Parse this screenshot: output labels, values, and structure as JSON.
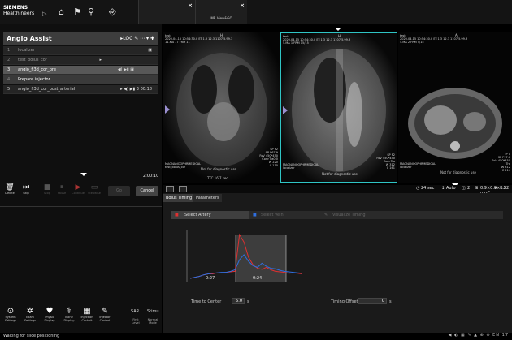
{
  "brand": {
    "line1": "SIEMENS",
    "line2": "Healthineers"
  },
  "topbar": {
    "icons": [
      "home-icon",
      "patient-browser-icon",
      "search-user-icon",
      "exam-icon"
    ],
    "tabs": [
      {
        "label": ""
      },
      {
        "label": "MR View&GO"
      }
    ]
  },
  "assist": {
    "title": "Angio Assist",
    "tools": "▸LOC ✎ ⋯ ▾ ✚",
    "rows": [
      {
        "num": "1",
        "name": "localizer",
        "ctrl": "▣"
      },
      {
        "num": "2",
        "name": "test_bolus_cor",
        "ctrl": "▸"
      },
      {
        "num": "3",
        "name": "angio_fl3d_cor_pre",
        "ctrl": "◀) ▶▮ ▣"
      },
      {
        "num": "4",
        "name": "Prepare injector",
        "ctrl": ""
      },
      {
        "num": "5",
        "name": "angio_fl3d_cor_post_arterial",
        "ctrl": "▸ ◀) ▶▮ 3     00:18"
      }
    ],
    "total_time": "2:00:10",
    "controls": [
      {
        "glyph": "🗑",
        "label": "Delete"
      },
      {
        "glyph": "⏭",
        "label": "Skip"
      },
      {
        "glyph": "■",
        "label": "Stop"
      },
      {
        "glyph": "⏸",
        "label": "Pause"
      },
      {
        "glyph": "▶",
        "label": "Continue"
      },
      {
        "glyph": "▭",
        "label": "Stepwise"
      }
    ],
    "go": "Go",
    "cancel": "Cancel"
  },
  "bottom_bar": {
    "items": [
      {
        "glyph": "⊙",
        "label": "System\nSettings"
      },
      {
        "glyph": "✲",
        "label": "Exam\nSettings"
      },
      {
        "glyph": "♥",
        "label": "Physio\nDisplay"
      },
      {
        "glyph": "⚕",
        "label": "Inline\nDisplay"
      },
      {
        "glyph": "▦",
        "label": "Injection\nCockpit"
      },
      {
        "glyph": "✎",
        "label": "Injector\nControl"
      }
    ],
    "sar": "SAR",
    "stimu": "Stimu",
    "sar_sub": "First\nLevel",
    "stimu_sub": "Normal\nMode"
  },
  "viewports": [
    {
      "overlay_tl": "test\n2020.04.15 10:54:30.0 ET:1.3 12.3 1107.5.99.3\n11.MA 17 FRM 11",
      "overlay_bl": "MAGNANOOPHRMEDICAL\ntest_bolus_cor",
      "overlay_br": "SP F2\nSP P67.9\nFoV 450*450\nCor>Tra0.0\nW 220\nC 110",
      "ndu": "Not for diagnostic use",
      "bottom": "TTC 16.7 sec",
      "orient_top": "H"
    },
    {
      "overlay_tl": "test\n2020.04.15 10:54:30.0 ET:1.3 12.3 1107.5.99.3\n5.MA 1 FRM 15/15",
      "overlay_bl": "MAGNANOOPHRMEDICAL\nlocalizer",
      "overlay_br": "SP F2\nFoV 450*450\nCor>Tra\nW 312\nC 161",
      "ndu": "Not for diagnostic use",
      "orient_top": "H"
    },
    {
      "overlay_tl": "test\n2020.04.15 10:54:30.0 ET:1.3 12.3 1107.5.99.3\n5.MA 2 FRM 5/15",
      "overlay_bl": "MAGNANOOPHRMEDICAL\nlocalizer",
      "overlay_br": "TP 0\nSP F17.6\nFoV 450*450\nTra\nW 312\nC 214",
      "ndu": "Not for diagnostic use",
      "orient_top": "A"
    }
  ],
  "status": {
    "time": "24 sec",
    "mode": "Auto",
    "count": "2",
    "voxel": "0.9×0.9×0.9 mm³",
    "factor": "1.22"
  },
  "lower": {
    "tabs": [
      "Bolus Timing",
      "Parameters"
    ],
    "steps": [
      "Select Artery",
      "Select Vein",
      "Visualize Timing"
    ],
    "marker1": "0:27",
    "marker2": "0:24",
    "ttc_label": "Time to Center",
    "ttc_value": "5.0",
    "ttc_unit": "s",
    "offset_label": "Timing Offset",
    "offset_value": "0",
    "offset_unit": "s"
  },
  "chart_data": {
    "type": "line",
    "series": [
      {
        "color": "#e03030",
        "values": [
          0.08,
          0.1,
          0.12,
          0.15,
          0.17,
          0.17,
          0.19,
          0.19,
          0.2,
          0.21,
          0.22,
          0.95,
          0.8,
          0.5,
          0.35,
          0.28,
          0.26,
          0.3,
          0.25,
          0.22,
          0.21,
          0.2,
          0.18,
          0.19,
          0.18,
          0.17
        ]
      },
      {
        "color": "#2f6fe0",
        "values": [
          0.08,
          0.1,
          0.12,
          0.15,
          0.17,
          0.18,
          0.19,
          0.2,
          0.2,
          0.22,
          0.25,
          0.45,
          0.55,
          0.42,
          0.33,
          0.3,
          0.38,
          0.32,
          0.28,
          0.27,
          0.24,
          0.22,
          0.21,
          0.2,
          0.19,
          0.18
        ]
      }
    ]
  },
  "footer": {
    "message": "Waiting for slice positioning",
    "tray": "◀ ◐ ▦ ✎ ▲ ⊕ ⊕ EN 17"
  }
}
